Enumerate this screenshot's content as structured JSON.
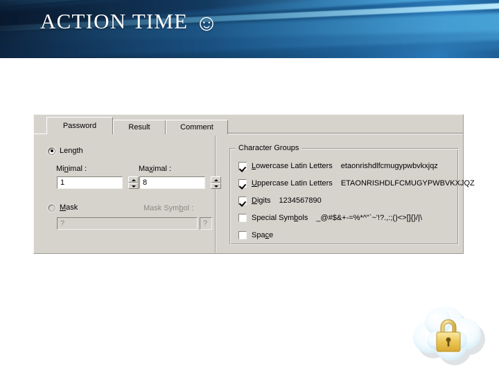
{
  "banner": {
    "title": "ACTION TIME",
    "smiley": "☺",
    "accent_dark": "#0a1c32",
    "accent_mid": "#14466f",
    "accent_light": "#8ed6fa"
  },
  "dialog": {
    "background": "#d6d3cd",
    "tabs": [
      {
        "label": "Password",
        "active": true
      },
      {
        "label": "Result",
        "active": false
      },
      {
        "label": "Comment",
        "active": false
      }
    ],
    "length_section": {
      "radio_label": "Length",
      "radio_selected": true,
      "minimal_label": "Minimal :",
      "minimal_value": "1",
      "maximal_label": "Maximal :",
      "maximal_value": "8"
    },
    "mask_section": {
      "radio_label": "Mask",
      "radio_selected": false,
      "mask_symbol_label": "Mask Symbol :",
      "mask_value": "?",
      "mask_symbol_value": "?",
      "disabled": true
    },
    "character_groups": {
      "title": "Character Groups",
      "items": [
        {
          "label": "Lowercase Latin Letters",
          "charset": "etaonrishdlfcmugypwbvkxjqz",
          "checked": true
        },
        {
          "label": "Uppercase Latin Letters",
          "charset": "ETAONRISHDLFCMUGYPWBVKXJQZ",
          "checked": true
        },
        {
          "label": "Digits",
          "charset": "1234567890",
          "checked": true
        },
        {
          "label": "Special Symbols",
          "charset": "_@#$&+-=%*^\"`~'!?.,:;()<>[]{}/|\\",
          "checked": false
        },
        {
          "label": "Space",
          "charset": "",
          "checked": false
        }
      ]
    }
  },
  "decoration": {
    "cloud_lock_icon": "cloud-padlock-icon",
    "cloud_color": "#eef7fc",
    "lock_color": "#f2c94c"
  }
}
